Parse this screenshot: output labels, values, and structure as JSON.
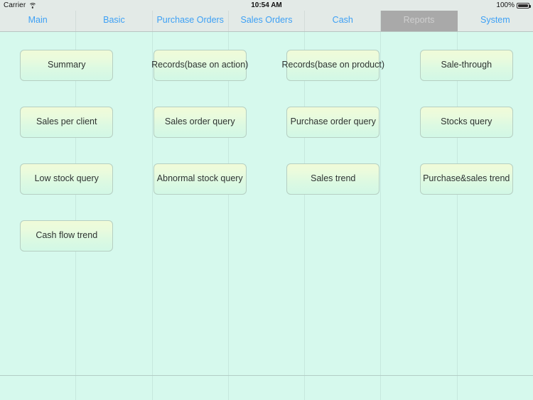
{
  "status_bar": {
    "carrier": "Carrier",
    "wifi_icon": "wifi-icon",
    "time": "10:54 AM",
    "battery_percent": "100%",
    "battery_icon": "battery-full-icon"
  },
  "tabs": [
    {
      "label": "Main",
      "selected": false
    },
    {
      "label": "Basic",
      "selected": false
    },
    {
      "label": "Purchase Orders",
      "selected": false
    },
    {
      "label": "Sales Orders",
      "selected": false
    },
    {
      "label": "Cash",
      "selected": false
    },
    {
      "label": "Reports",
      "selected": true
    },
    {
      "label": "System",
      "selected": false
    }
  ],
  "colors": {
    "page_background": "#d6f9ed",
    "tab_background": "#e3eae7",
    "tab_text": "#3da0f5",
    "tab_selected_background": "#a9a9a9",
    "tab_selected_text": "#cfcfcf",
    "button_border": "#b6cfc2",
    "button_gradient_top": "#f0fbd8",
    "button_gradient_bottom": "#d2f8e6",
    "button_text": "#2e3331",
    "separator": "#b3cdc6"
  },
  "menu": {
    "rows": [
      [
        {
          "label": "Summary"
        },
        {
          "label": "Records(base on action)"
        },
        {
          "label": "Records(base on product)"
        },
        {
          "label": "Sale-through"
        }
      ],
      [
        {
          "label": "Sales per client"
        },
        {
          "label": "Sales order query"
        },
        {
          "label": "Purchase order query"
        },
        {
          "label": "Stocks query"
        }
      ],
      [
        {
          "label": "Low stock query"
        },
        {
          "label": "Abnormal stock query"
        },
        {
          "label": "Sales trend"
        },
        {
          "label": "Purchase&sales trend"
        }
      ],
      [
        {
          "label": "Cash flow trend"
        },
        {
          "label": ""
        },
        {
          "label": ""
        },
        {
          "label": ""
        }
      ]
    ]
  }
}
